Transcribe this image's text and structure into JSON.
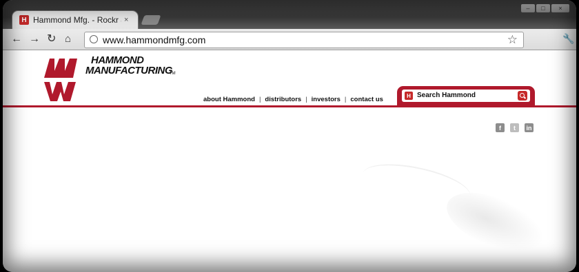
{
  "browser": {
    "tab_title": "Hammond Mfg. - Rockr & ",
    "tab_close": "×",
    "url": "www.hammondmfg.com",
    "nav": {
      "back_icon": "arrow-left-icon",
      "forward_icon": "arrow-right-icon",
      "reload_icon": "reload-icon",
      "home_icon": "home-icon"
    },
    "window_controls": [
      "minimize",
      "maximize",
      "close"
    ]
  },
  "site": {
    "brand_line1": "HAMMOND",
    "brand_line2": "MANUFACTURING",
    "trademark": "TM",
    "nav_links": [
      {
        "label": "about Hammond"
      },
      {
        "label": "distributors"
      },
      {
        "label": "investors"
      },
      {
        "label": "contact us"
      }
    ],
    "search_placeholder": "Search Hammond",
    "social": [
      {
        "name": "facebook",
        "glyph": "f"
      },
      {
        "name": "twitter",
        "glyph": "t"
      },
      {
        "name": "linkedin",
        "glyph": "in"
      }
    ],
    "accent_color": "#b0192c"
  }
}
